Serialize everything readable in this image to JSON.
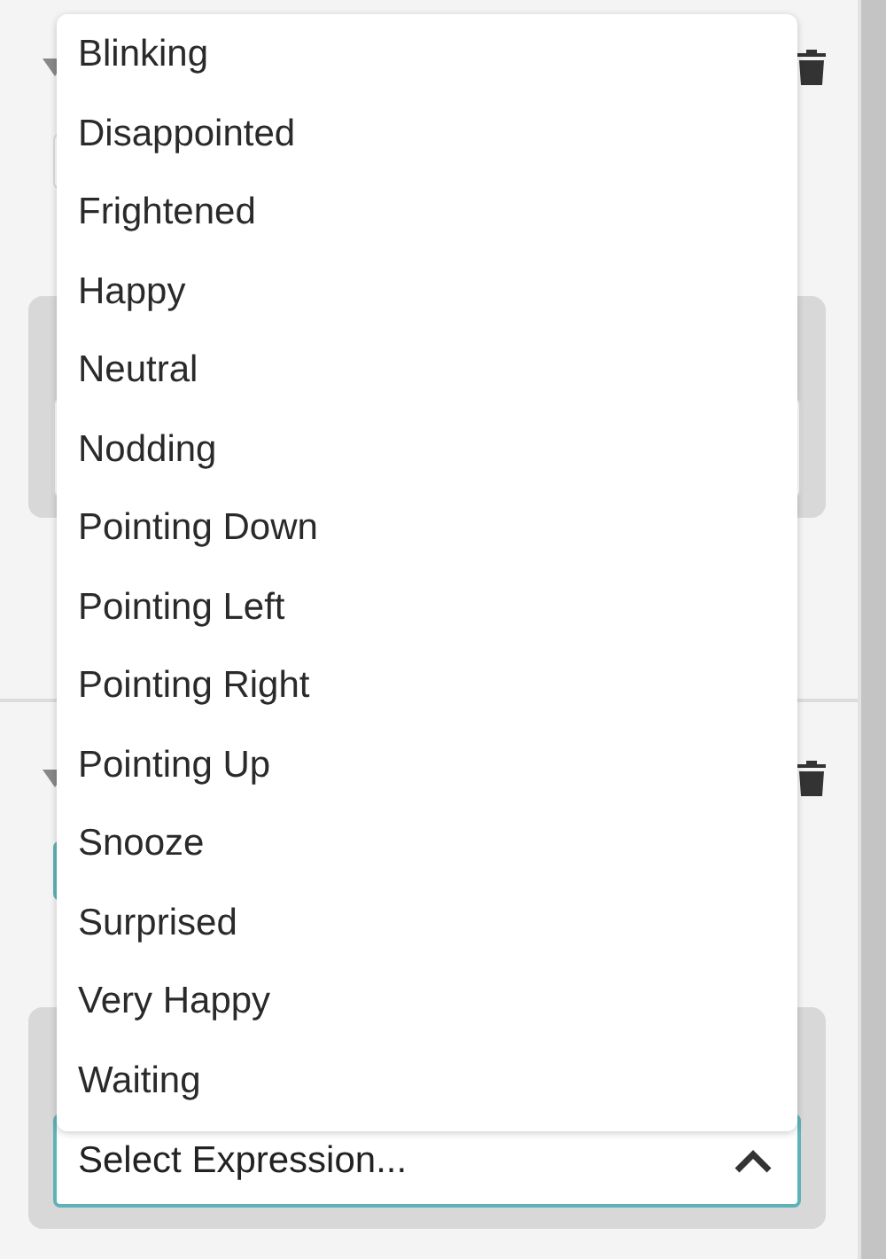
{
  "expression_select": {
    "placeholder": "Select Expression...",
    "expanded": true,
    "options": [
      {
        "label": "Blinking"
      },
      {
        "label": "Disappointed"
      },
      {
        "label": "Frightened"
      },
      {
        "label": "Happy"
      },
      {
        "label": "Neutral"
      },
      {
        "label": "Nodding"
      },
      {
        "label": "Pointing Down"
      },
      {
        "label": "Pointing Left"
      },
      {
        "label": "Pointing Right"
      },
      {
        "label": "Pointing Up"
      },
      {
        "label": "Snooze"
      },
      {
        "label": "Surprised"
      },
      {
        "label": "Very Happy"
      },
      {
        "label": "Waiting"
      }
    ]
  }
}
